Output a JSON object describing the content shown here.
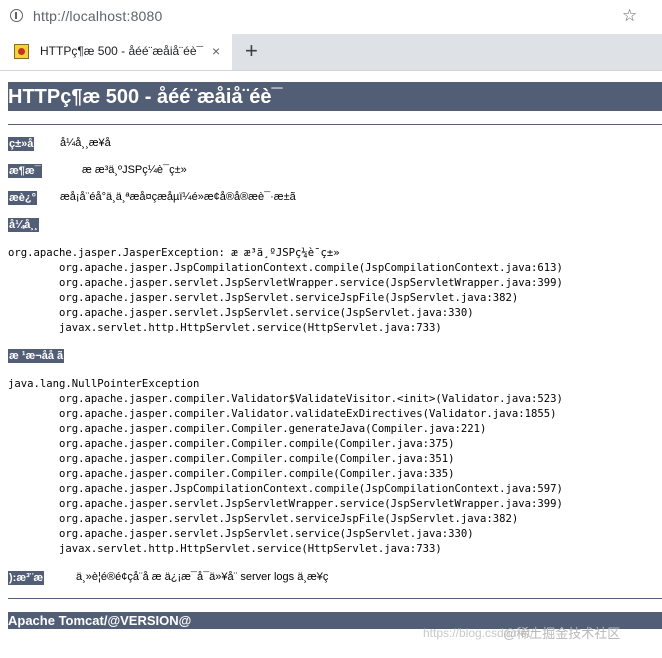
{
  "browser": {
    "url": "http://localhost:8080",
    "tab_title": "HTTPç¶æ 500 - åéé¨æåiå¨éè¯",
    "tab_close": "×",
    "new_tab": "+",
    "star": "☆"
  },
  "page": {
    "title": "HTTPç¶æ 500 - åéé¨æåiå¨éè¯",
    "type_label": "ç±»å",
    "type_value": "å¼å¸¸æ¥å",
    "message_label": "æ¶æ¯",
    "message_value": "æ æ³ä¸ºJSPç¼è¯ç±»",
    "description_label": "æè¿°",
    "description_value": "æå¡å¨éå°ä¸ä¸ªæå¤çæåµï¼é»æ­¢å®å®æè¯·æ±ã",
    "exception_label": "å¼å¸¸",
    "exception_trace": "org.apache.jasper.JasperException: æ æ³ä¸ºJSPç¼è¯ç±»\n        org.apache.jasper.JspCompilationContext.compile(JspCompilationContext.java:613)\n        org.apache.jasper.servlet.JspServletWrapper.service(JspServletWrapper.java:399)\n        org.apache.jasper.servlet.JspServlet.serviceJspFile(JspServlet.java:382)\n        org.apache.jasper.servlet.JspServlet.service(JspServlet.java:330)\n        javax.servlet.http.HttpServlet.service(HttpServlet.java:733)",
    "root_cause_label": "æ ¹æ¬åå ã",
    "root_cause_trace": "java.lang.NullPointerException\n        org.apache.jasper.compiler.Validator$ValidateVisitor.<init>(Validator.java:523)\n        org.apache.jasper.compiler.Validator.validateExDirectives(Validator.java:1855)\n        org.apache.jasper.compiler.Compiler.generateJava(Compiler.java:221)\n        org.apache.jasper.compiler.Compiler.compile(Compiler.java:375)\n        org.apache.jasper.compiler.Compiler.compile(Compiler.java:351)\n        org.apache.jasper.compiler.Compiler.compile(Compiler.java:335)\n        org.apache.jasper.JspCompilationContext.compile(JspCompilationContext.java:597)\n        org.apache.jasper.servlet.JspServletWrapper.service(JspServletWrapper.java:399)\n        org.apache.jasper.servlet.JspServlet.serviceJspFile(JspServlet.java:382)\n        org.apache.jasper.servlet.JspServlet.service(JspServlet.java:330)\n        javax.servlet.http.HttpServlet.service(HttpServlet.java:733)",
    "note_label": "):æ³¨æ",
    "note_value": "ä¸»è¦é®é¢çå¨å æ ä¿¡æ¯å¯ä»¥å¨ server logs ä¸­æ¥ç",
    "footer": "Apache Tomcat/@VERSION@"
  },
  "watermark": {
    "url_text": "https://blog.csdn.net/",
    "logo_text": "@稀土掘金技术社区"
  },
  "colors": {
    "tomcat_bar": "#525d76",
    "tab_strip": "#dee1e6"
  }
}
